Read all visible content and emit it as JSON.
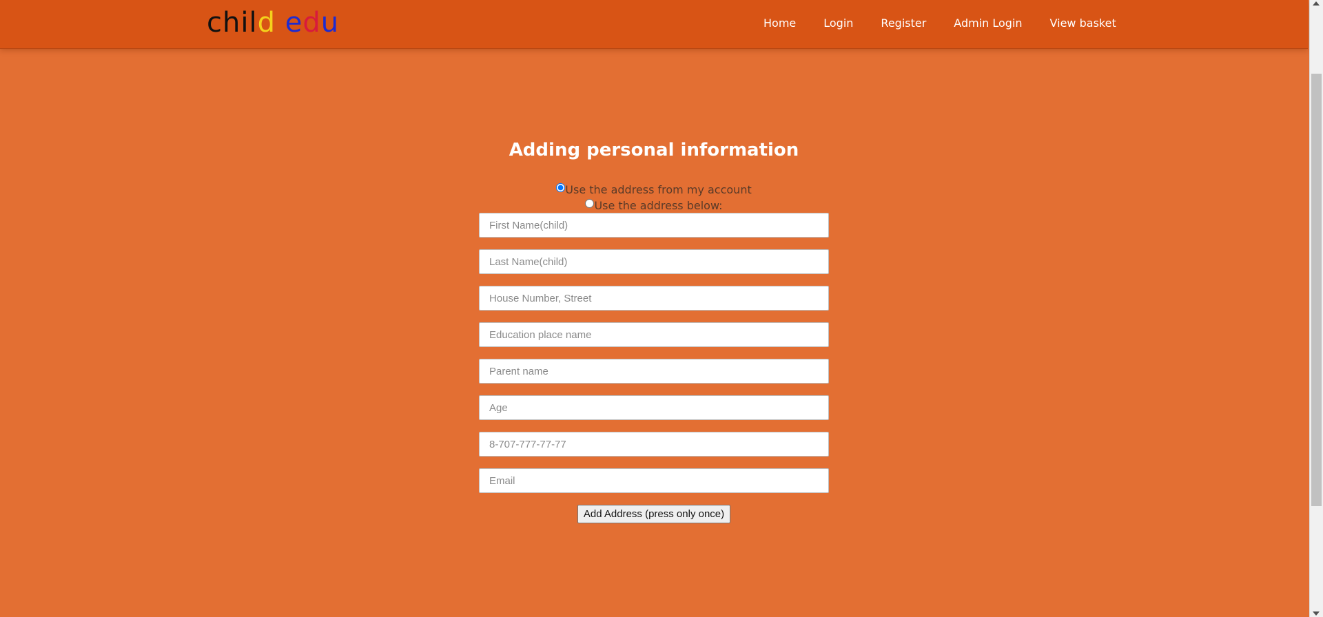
{
  "header": {
    "logo": {
      "letters": [
        "c",
        "h",
        "i",
        "l",
        "d",
        " ",
        "e",
        "d",
        "u"
      ],
      "accent_colors": {
        "yellow": "#f4d21c",
        "blue": "#1e2bd0",
        "red": "#d81a3c"
      }
    },
    "nav": [
      "Home",
      "Login",
      "Register",
      "Admin Login",
      "View basket"
    ]
  },
  "form": {
    "title": "Adding personal information",
    "address_options": [
      {
        "label": "Use the address from my account",
        "checked": true
      },
      {
        "label": "Use the address below:",
        "checked": false
      }
    ],
    "fields": [
      {
        "placeholder": "First Name(child)",
        "value": ""
      },
      {
        "placeholder": "Last Name(child)",
        "value": ""
      },
      {
        "placeholder": "House Number, Street",
        "value": ""
      },
      {
        "placeholder": "Education place name",
        "value": ""
      },
      {
        "placeholder": "Parent name",
        "value": ""
      },
      {
        "placeholder": "Age",
        "value": ""
      },
      {
        "placeholder": "8-707-777-77-77",
        "value": ""
      },
      {
        "placeholder": "Email",
        "value": ""
      }
    ],
    "submit_label": "Add Address (press only once)"
  },
  "colors": {
    "page_background": "#e36f33",
    "navbar_background": "#d85415",
    "title_text": "#ffffff"
  }
}
